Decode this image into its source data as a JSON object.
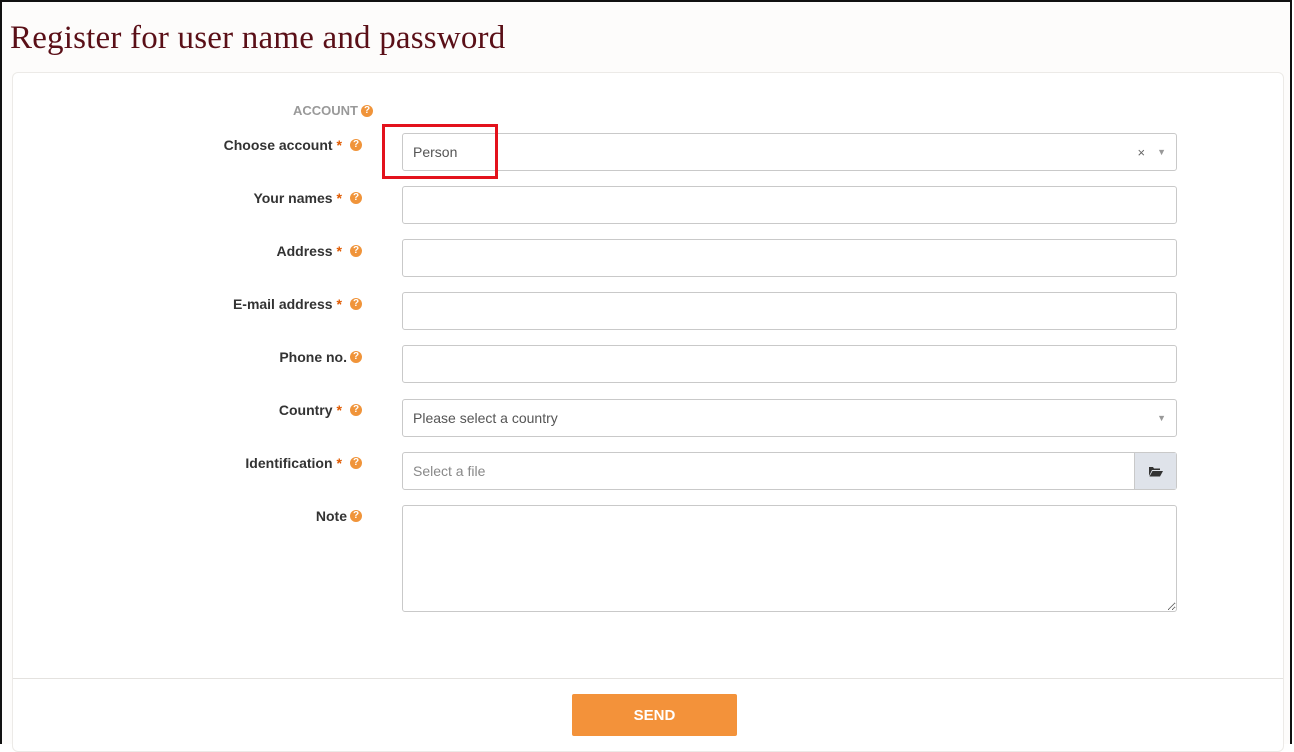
{
  "page_title": "Register for user name and password",
  "section_label": "ACCOUNT",
  "fields": {
    "choose_account": {
      "label": "Choose account",
      "required_mark": "*",
      "value": "Person",
      "clear_glyph": "×"
    },
    "your_names": {
      "label": "Your names",
      "required_mark": "*",
      "value": ""
    },
    "address": {
      "label": "Address",
      "required_mark": "*",
      "value": ""
    },
    "email": {
      "label": "E-mail address",
      "required_mark": "*",
      "value": ""
    },
    "phone": {
      "label": "Phone no.",
      "value": ""
    },
    "country": {
      "label": "Country",
      "required_mark": "*",
      "placeholder": "Please select a country"
    },
    "identification": {
      "label": "Identification",
      "required_mark": "*",
      "placeholder": "Select a file"
    },
    "note": {
      "label": "Note",
      "value": ""
    }
  },
  "help_glyph": "?",
  "send_label": "SEND",
  "colors": {
    "title": "#5a0f17",
    "accent": "#f3923a",
    "help_icon": "#f0943a",
    "required": "#e05a00",
    "highlight": "#e3121c"
  },
  "icons": {
    "help": "help-icon",
    "dropdown": "chevron-down-icon",
    "clear": "clear-icon",
    "folder": "folder-open-icon"
  }
}
